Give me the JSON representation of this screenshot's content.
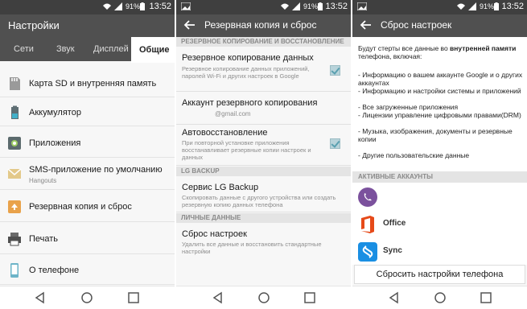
{
  "status": {
    "battery": "91%",
    "time": "13:52"
  },
  "panel1": {
    "title": "Настройки",
    "tabs": [
      "Сети",
      "Звук",
      "Дисплей",
      "Общие"
    ],
    "items": [
      {
        "label": "Карта SD и внутренняя память",
        "sub": ""
      },
      {
        "label": "Аккумулятор",
        "sub": ""
      },
      {
        "label": "Приложения",
        "sub": ""
      },
      {
        "label": "SMS-приложение по умолчанию",
        "sub": "Hangouts"
      },
      {
        "label": "Резервная копия и сброс",
        "sub": ""
      },
      {
        "label": "Печать",
        "sub": ""
      },
      {
        "label": "О телефоне",
        "sub": ""
      }
    ]
  },
  "panel2": {
    "title": "Резервная копия и сброс",
    "section1": "РЕЗЕРВНОЕ КОПИРОВАНИЕ И ВОССТАНОВЛЕНИЕ",
    "backup_title": "Резервное копирование данных",
    "backup_desc": "Резервное копирование данных приложений, паролей Wi-Fi и других настроек в Google",
    "account_title": "Аккаунт резервного копирования",
    "account_value": "@gmail.com",
    "restore_title": "Автовосстановление",
    "restore_desc": "При повторной установке приложения восстанавливает резервные копии настроек и данных",
    "section2": "LG BACKUP",
    "lg_title": "Сервис LG Backup",
    "lg_desc": "Скопировать данные с другого устройства или создать резервную копию данных телефона",
    "section3": "ЛИЧНЫЕ ДАННЫЕ",
    "reset_title": "Сброс настроек",
    "reset_desc": "Удалить все данные и восстановить стандартные настройки"
  },
  "panel3": {
    "title": "Сброс настроек",
    "intro_1": "Будут стерты все данные во ",
    "intro_bold": "внутренней памяти",
    "intro_2": " телефона, включая:",
    "bullets": [
      "- Информацию о вашем аккаунте Google и о других аккаунтах",
      "- Информацию и настройки системы и приложений",
      "- Все загруженные приложения",
      "- Лицензии управление цифровыми правами(DRM)",
      "- Музыка, изображения, документы и резервные копии",
      "- Другие пользовательские данные"
    ],
    "accounts_header": "АКТИВНЫЕ АККАУНТЫ",
    "accounts": [
      "",
      "Office",
      "Sync"
    ],
    "reset_button": "Сбросить настройки телефона"
  },
  "colors": {
    "appbar": "#505050",
    "statusbar": "#3f3f3f",
    "checkbox": "#5aa0b0",
    "viber": "#7b519d",
    "office": "#e64a19",
    "shazam": "#1a8fe3"
  }
}
